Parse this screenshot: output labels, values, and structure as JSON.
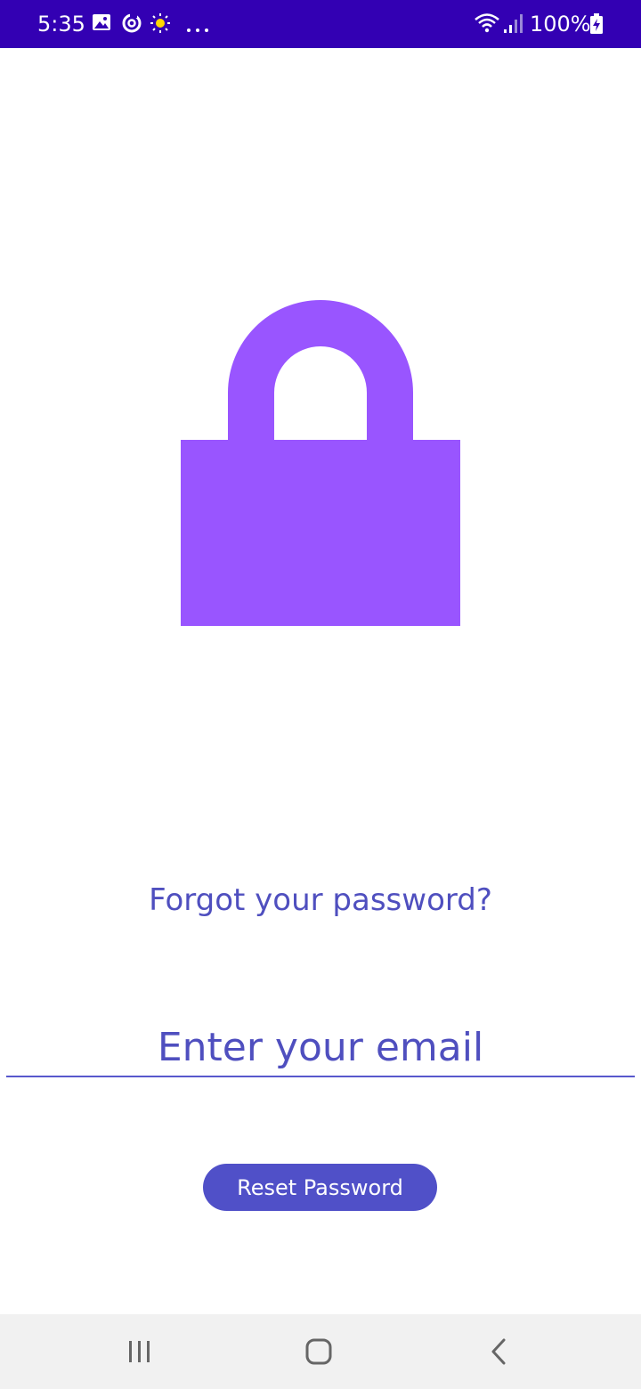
{
  "status_bar": {
    "time": "5:35",
    "battery": "100%",
    "background": "#3300b3",
    "icons": [
      "gallery-icon",
      "sync-icon",
      "weather-sun-icon",
      "more-dots-icon",
      "wifi-icon",
      "signal-icon",
      "battery-charging-icon"
    ]
  },
  "lock": {
    "icon": "lock-icon",
    "color": "#9955ff"
  },
  "forgot": {
    "text": "Forgot your password?",
    "color": "#4f4fbf"
  },
  "email": {
    "placeholder": "Enter your email",
    "value": ""
  },
  "reset_button": {
    "label": "Reset Password",
    "color": "#5050c8"
  },
  "nav_bar": {
    "icons": [
      "recents-icon",
      "home-icon",
      "back-icon"
    ]
  }
}
